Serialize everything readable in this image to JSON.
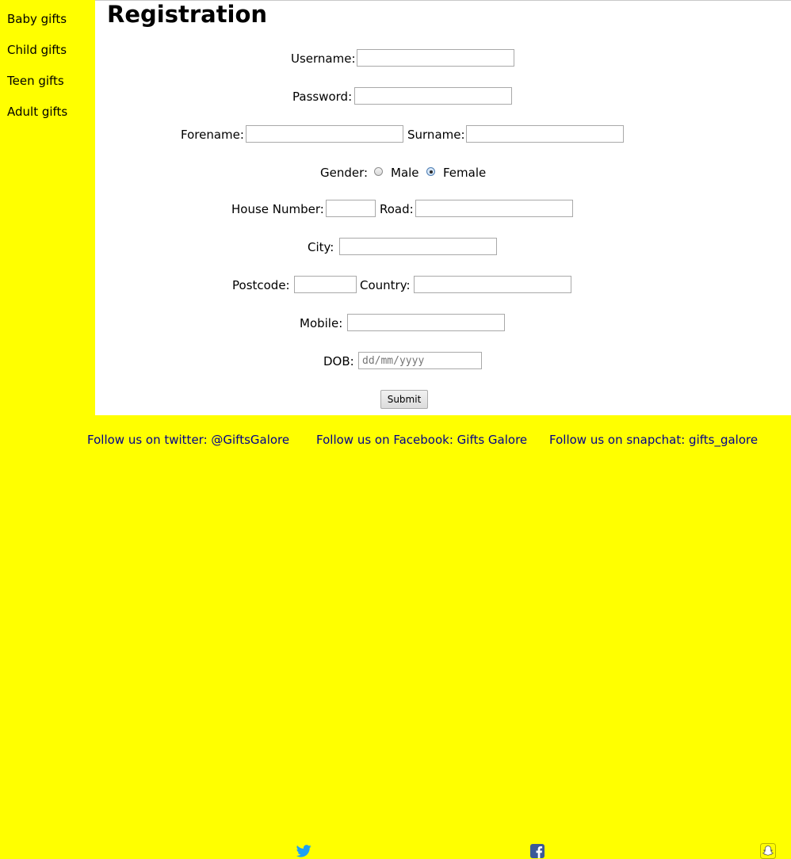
{
  "sidebar": {
    "items": [
      {
        "label": "Baby gifts"
      },
      {
        "label": "Child gifts"
      },
      {
        "label": "Teen gifts"
      },
      {
        "label": "Adult gifts"
      }
    ]
  },
  "main": {
    "title": "Registration",
    "labels": {
      "username": "Username:",
      "password": "Password:",
      "forename": "Forename:",
      "surname": "Surname:",
      "gender": "Gender:",
      "male": "Male",
      "female": "Female",
      "house_number": "House Number:",
      "road": "Road:",
      "city": "City:",
      "postcode": "Postcode:",
      "country": "Country:",
      "mobile": "Mobile:",
      "dob": "DOB:"
    },
    "gender_selected": "Female",
    "dob_placeholder": "dd/mm/yyyy",
    "submit_label": "Submit"
  },
  "footer": {
    "twitter_text": "Follow us on twitter: @GiftsGalore",
    "facebook_text": "Follow us on Facebook: Gifts Galore",
    "snapchat_text": "Follow us on snapchat: gifts_galore",
    "link_color": "#00008b",
    "twitter_color": "#1da1f2",
    "facebook_color": "#3b5998",
    "snapchat_color": "#fffc00"
  },
  "colors": {
    "background": "#ffff00",
    "content_background": "#ffffff"
  }
}
